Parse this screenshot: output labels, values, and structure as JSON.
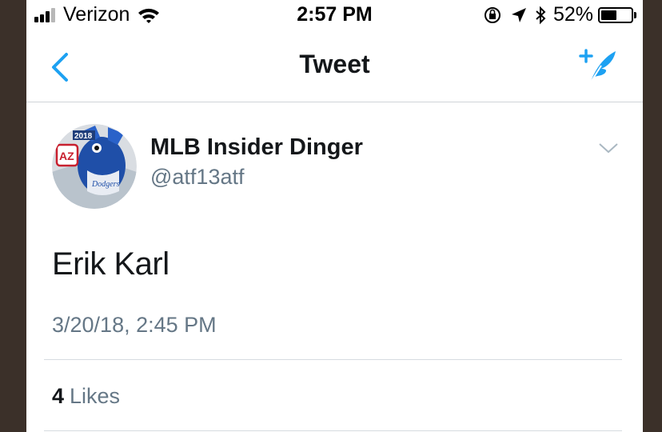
{
  "status_bar": {
    "carrier": "Verizon",
    "time": "2:57 PM",
    "battery_percent": "52%",
    "battery_level": 0.52,
    "icons": [
      "signal-icon",
      "wifi-icon",
      "orientation-lock-icon",
      "location-icon",
      "bluetooth-icon",
      "battery-icon"
    ]
  },
  "nav": {
    "title": "Tweet",
    "back_icon": "back-chevron-icon",
    "compose_icon": "compose-tweet-icon"
  },
  "tweet": {
    "author": {
      "display_name": "MLB Insider Dinger",
      "handle": "@atf13atf",
      "avatar_badge_year": "2018",
      "avatar_badge_state": "AZ",
      "avatar_jersey_text": "Dodgers"
    },
    "text": "Erik Karl",
    "timestamp": "3/20/18, 2:45 PM",
    "likes_count": "4",
    "likes_label": "Likes"
  },
  "colors": {
    "accent": "#1da1f2",
    "text_primary": "#14171a",
    "text_secondary": "#657786",
    "divider": "#d6dbe0",
    "frame": "#3b3029"
  }
}
